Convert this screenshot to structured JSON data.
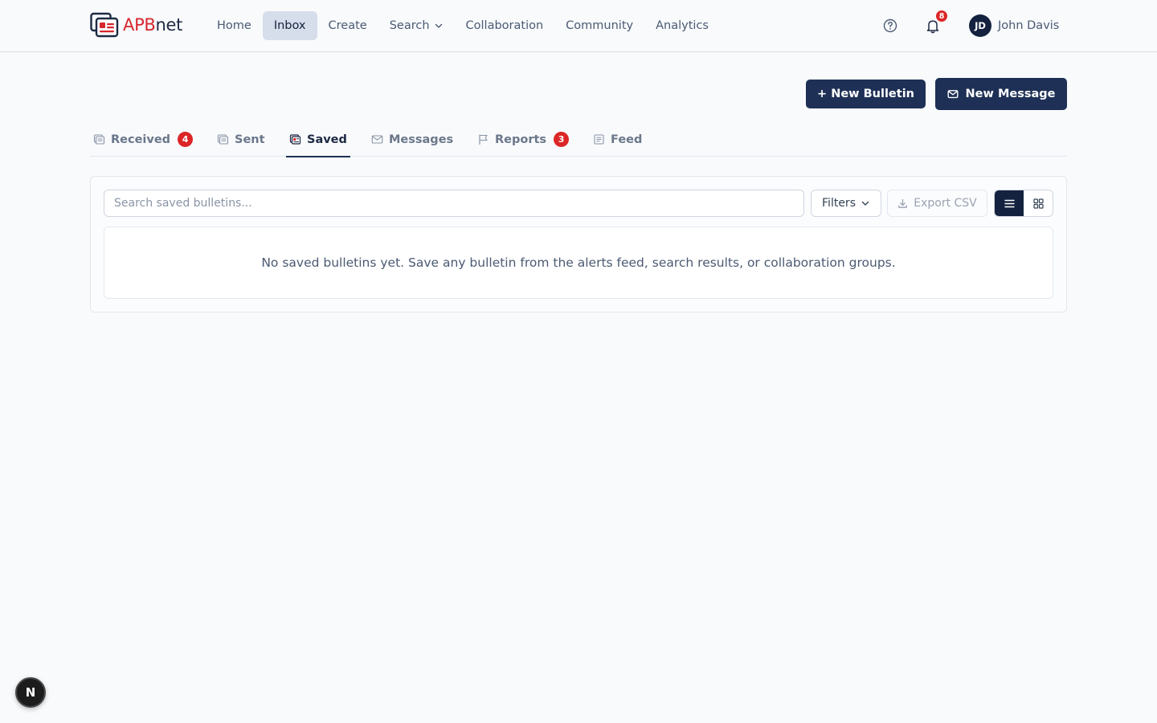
{
  "brand": {
    "part1": "APB",
    "part2": "net",
    "logo_icon": "bulletin-logo-icon"
  },
  "nav": {
    "links": [
      {
        "label": "Home"
      },
      {
        "label": "Inbox",
        "active": true
      },
      {
        "label": "Create"
      },
      {
        "label": "Search",
        "has_dropdown": true
      },
      {
        "label": "Collaboration"
      },
      {
        "label": "Community"
      },
      {
        "label": "Analytics"
      }
    ],
    "help_icon": "question-circle-icon",
    "notifications": {
      "icon": "bell-icon",
      "count": "8"
    },
    "user": {
      "initials": "JD",
      "name": "John Davis"
    }
  },
  "actions": {
    "new_bulletin": "+ New Bulletin",
    "new_message": "New Message"
  },
  "tabs": [
    {
      "label": "Received",
      "badge": "4",
      "icon": "document-icon"
    },
    {
      "label": "Sent",
      "badge": "",
      "icon": "document-icon"
    },
    {
      "label": "Saved",
      "badge": "",
      "icon": "bookmark-document-icon",
      "active": true
    },
    {
      "label": "Messages",
      "badge": "",
      "icon": "envelope-icon"
    },
    {
      "label": "Reports",
      "badge": "3",
      "icon": "flag-icon"
    },
    {
      "label": "Feed",
      "badge": "",
      "icon": "feed-icon"
    }
  ],
  "toolbar": {
    "search_placeholder": "Search saved bulletins...",
    "search_value": "",
    "filters_label": "Filters",
    "export_label": "Export CSV",
    "view_mode": "list"
  },
  "empty_state": "No saved bulletins yet. Save any bulletin from the alerts feed, search results, or collaboration groups.",
  "floating_button": "N",
  "colors": {
    "brand_red": "#d7262e",
    "primary_navy": "#1e3055",
    "badge_red": "#dc2626"
  }
}
